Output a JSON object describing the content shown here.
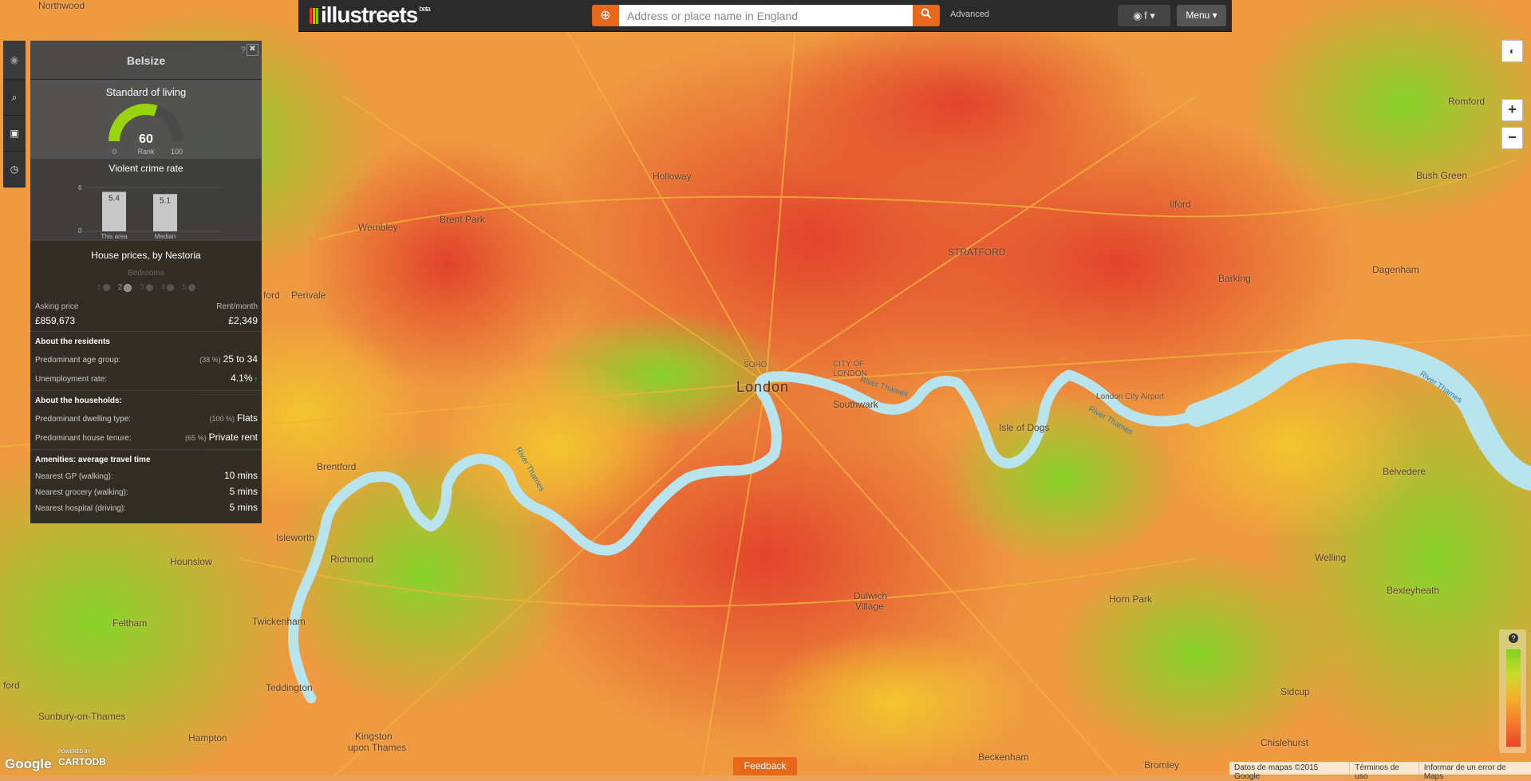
{
  "header": {
    "logo": "illustreets",
    "logo_badge": "beta",
    "locate_icon": "crosshair-icon",
    "search_placeholder": "Address or place name in England",
    "search_icon": "search-icon",
    "advanced": "Advanced",
    "social_label": " f",
    "menu": "Menu ▾"
  },
  "tools": [
    {
      "name": "eye-toggle",
      "icon": "eye-icon",
      "glyph": "◉"
    },
    {
      "name": "zoom-to-area",
      "icon": "zoom-icon",
      "glyph": "⌕"
    },
    {
      "name": "snapshot",
      "icon": "camera-icon",
      "glyph": "▣"
    },
    {
      "name": "history",
      "icon": "clock-icon",
      "glyph": "◷"
    }
  ],
  "panel": {
    "title": "Belsize",
    "help": "?",
    "close": "✖",
    "standard_of_living": {
      "title": "Standard of living",
      "value": "60",
      "min": "0",
      "rank_label": "Rank",
      "max": "100",
      "gauge_fraction": 0.6,
      "gauge_color": "#9ad40e"
    },
    "crime": {
      "title": "Violent crime rate",
      "y_max": "6",
      "y_min": "0",
      "bars": [
        {
          "label": "This area",
          "value": 5.4,
          "text": "5.4"
        },
        {
          "label": "Median",
          "value": 5.1,
          "text": "5.1"
        }
      ]
    },
    "house": {
      "title": "House prices, by Nestoria",
      "bedrooms_label": "Bedrooms",
      "bedrooms": [
        "1",
        "2",
        "3",
        "4",
        "5"
      ],
      "bedrooms_selected": "2",
      "asking_label": "Asking price",
      "rent_label": "Rent/month",
      "asking": "£859,673",
      "rent": "£2,349"
    },
    "residents": {
      "title": "About the residents",
      "age_label": "Predominant age group:",
      "age_pct": "(38 %)",
      "age_value": "25 to 34",
      "unemp_label": "Unemployment rate:",
      "unemp_value": "4.1%",
      "unemp_trend": "↑"
    },
    "households": {
      "title": "About the households:",
      "dwelling_label": "Predominant dwelling type:",
      "dwelling_pct": "(100 %)",
      "dwelling_value": "Flats",
      "tenure_label": "Predominant house tenure:",
      "tenure_pct": "(65 %)",
      "tenure_value": "Private rent"
    },
    "amenities": {
      "title": "Amenities: average travel time",
      "gp_label": "Nearest GP (walking):",
      "gp_value": "10 mins",
      "grocery_label": "Nearest grocery (walking):",
      "grocery_value": "5 mins",
      "hospital_label": "Nearest hospital (driving):",
      "hospital_value": "5 mins"
    }
  },
  "map_places": {
    "london": "London",
    "holloway": "Holloway",
    "stratford": "STRATFORD",
    "ilford": "Ilford",
    "romford": "Romford",
    "dagenham": "Dagenham",
    "barking": "Barking",
    "wembley": "Wembley",
    "brent_park": "Brent Park",
    "perivale": "Perivale",
    "brentford": "Brentford",
    "isleworth": "Isleworth",
    "hounslow": "Hounslow",
    "richmond": "Richmond",
    "twickenham": "Twickenham",
    "feltham": "Feltham",
    "teddington": "Teddington",
    "sunbury": "Sunbury-on-Thames",
    "hampton": "Hampton",
    "kingston": "Kingston",
    "kingston2": "upon Thames",
    "southwark": "Southwark",
    "soho": "SOHO",
    "city": "CITY OF",
    "city2": "LONDON",
    "isle_of_dogs": "Isle of Dogs",
    "london_city_airport": "London City Airport",
    "dulwich": "Dulwich",
    "dulwich2": "Village",
    "herne_hill": "Horn Park",
    "welling": "Welling",
    "bexleyheath": "Bexleyheath",
    "belvedere": "Belvedere",
    "sidcup": "Sidcup",
    "chislehurst": "Chislehurst",
    "beckenham": "Beckenham",
    "bromley": "Bromley",
    "bush_green": "Bush Green",
    "northwood": "Northwood",
    "river_thames": "River Thames",
    "ford": "ford"
  },
  "map_controls": {
    "globe": "globe-icon",
    "zoom_in": "+",
    "zoom_out": "−",
    "legend_help": "?"
  },
  "footer": {
    "feedback": "Feedback",
    "google": "Google",
    "powered_by": "POWERED BY",
    "cartodb": "CARTODB",
    "attribution": [
      "Datos de mapas ©2015 Google",
      "Términos de uso",
      "Informar de un error de Maps"
    ]
  },
  "colors": {
    "accent": "#e8671b",
    "heat_high": "#e8452a",
    "heat_mid": "#f5a02c",
    "heat_low": "#7ed21e",
    "river": "#b8e4ee"
  }
}
